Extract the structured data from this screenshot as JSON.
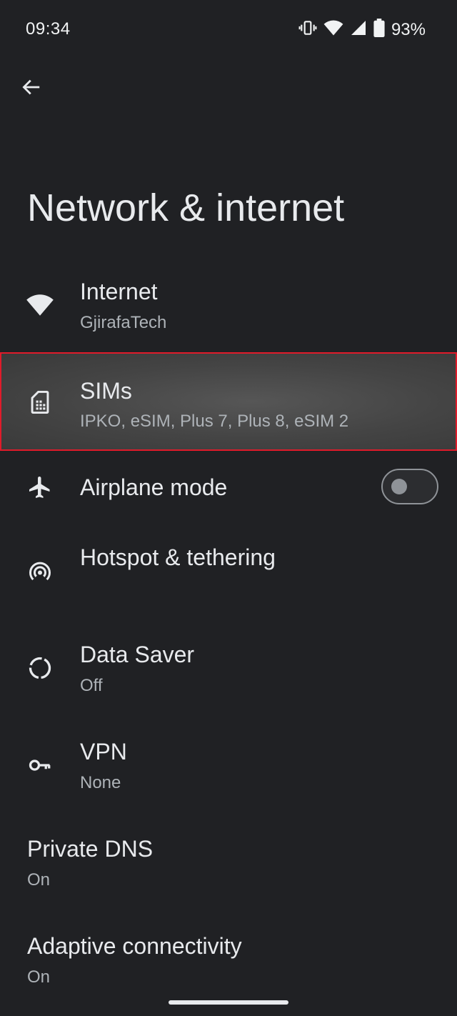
{
  "status": {
    "time": "09:34",
    "battery": "93%"
  },
  "page": {
    "title": "Network & internet"
  },
  "items": [
    {
      "label": "Internet",
      "subtitle": "GjirafaTech",
      "icon": "wifi-icon"
    },
    {
      "label": "SIMs",
      "subtitle": "IPKO, eSIM, Plus 7, Plus 8, eSIM 2",
      "icon": "sim-card-icon"
    },
    {
      "label": "Airplane mode",
      "icon": "airplane-icon",
      "toggle": "off"
    },
    {
      "label": "Hotspot & tethering",
      "icon": "hotspot-icon"
    },
    {
      "label": "Data Saver",
      "subtitle": "Off",
      "icon": "data-saver-icon"
    },
    {
      "label": "VPN",
      "subtitle": "None",
      "icon": "vpn-key-icon"
    },
    {
      "label": "Private DNS",
      "subtitle": "On"
    },
    {
      "label": "Adaptive connectivity",
      "subtitle": "On"
    }
  ]
}
